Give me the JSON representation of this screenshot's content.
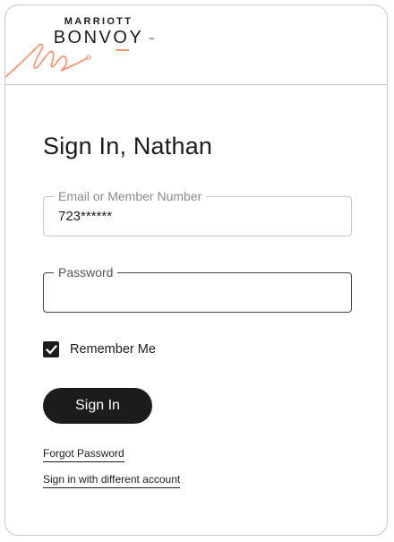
{
  "brand": {
    "top_text": "MARRIOTT",
    "main_text": "BONVOY",
    "trademark": "™",
    "accent_color": "#ff8d6b"
  },
  "form": {
    "title": "Sign In, Nathan",
    "email": {
      "label": "Email or Member Number",
      "value": "723******"
    },
    "password": {
      "label": "Password",
      "value": ""
    },
    "remember_me": {
      "label": "Remember Me",
      "checked": true,
      "icon": "check-icon"
    },
    "submit_label": "Sign In"
  },
  "links": {
    "forgot_password": "Forgot Password",
    "different_account": "Sign in with different account"
  }
}
